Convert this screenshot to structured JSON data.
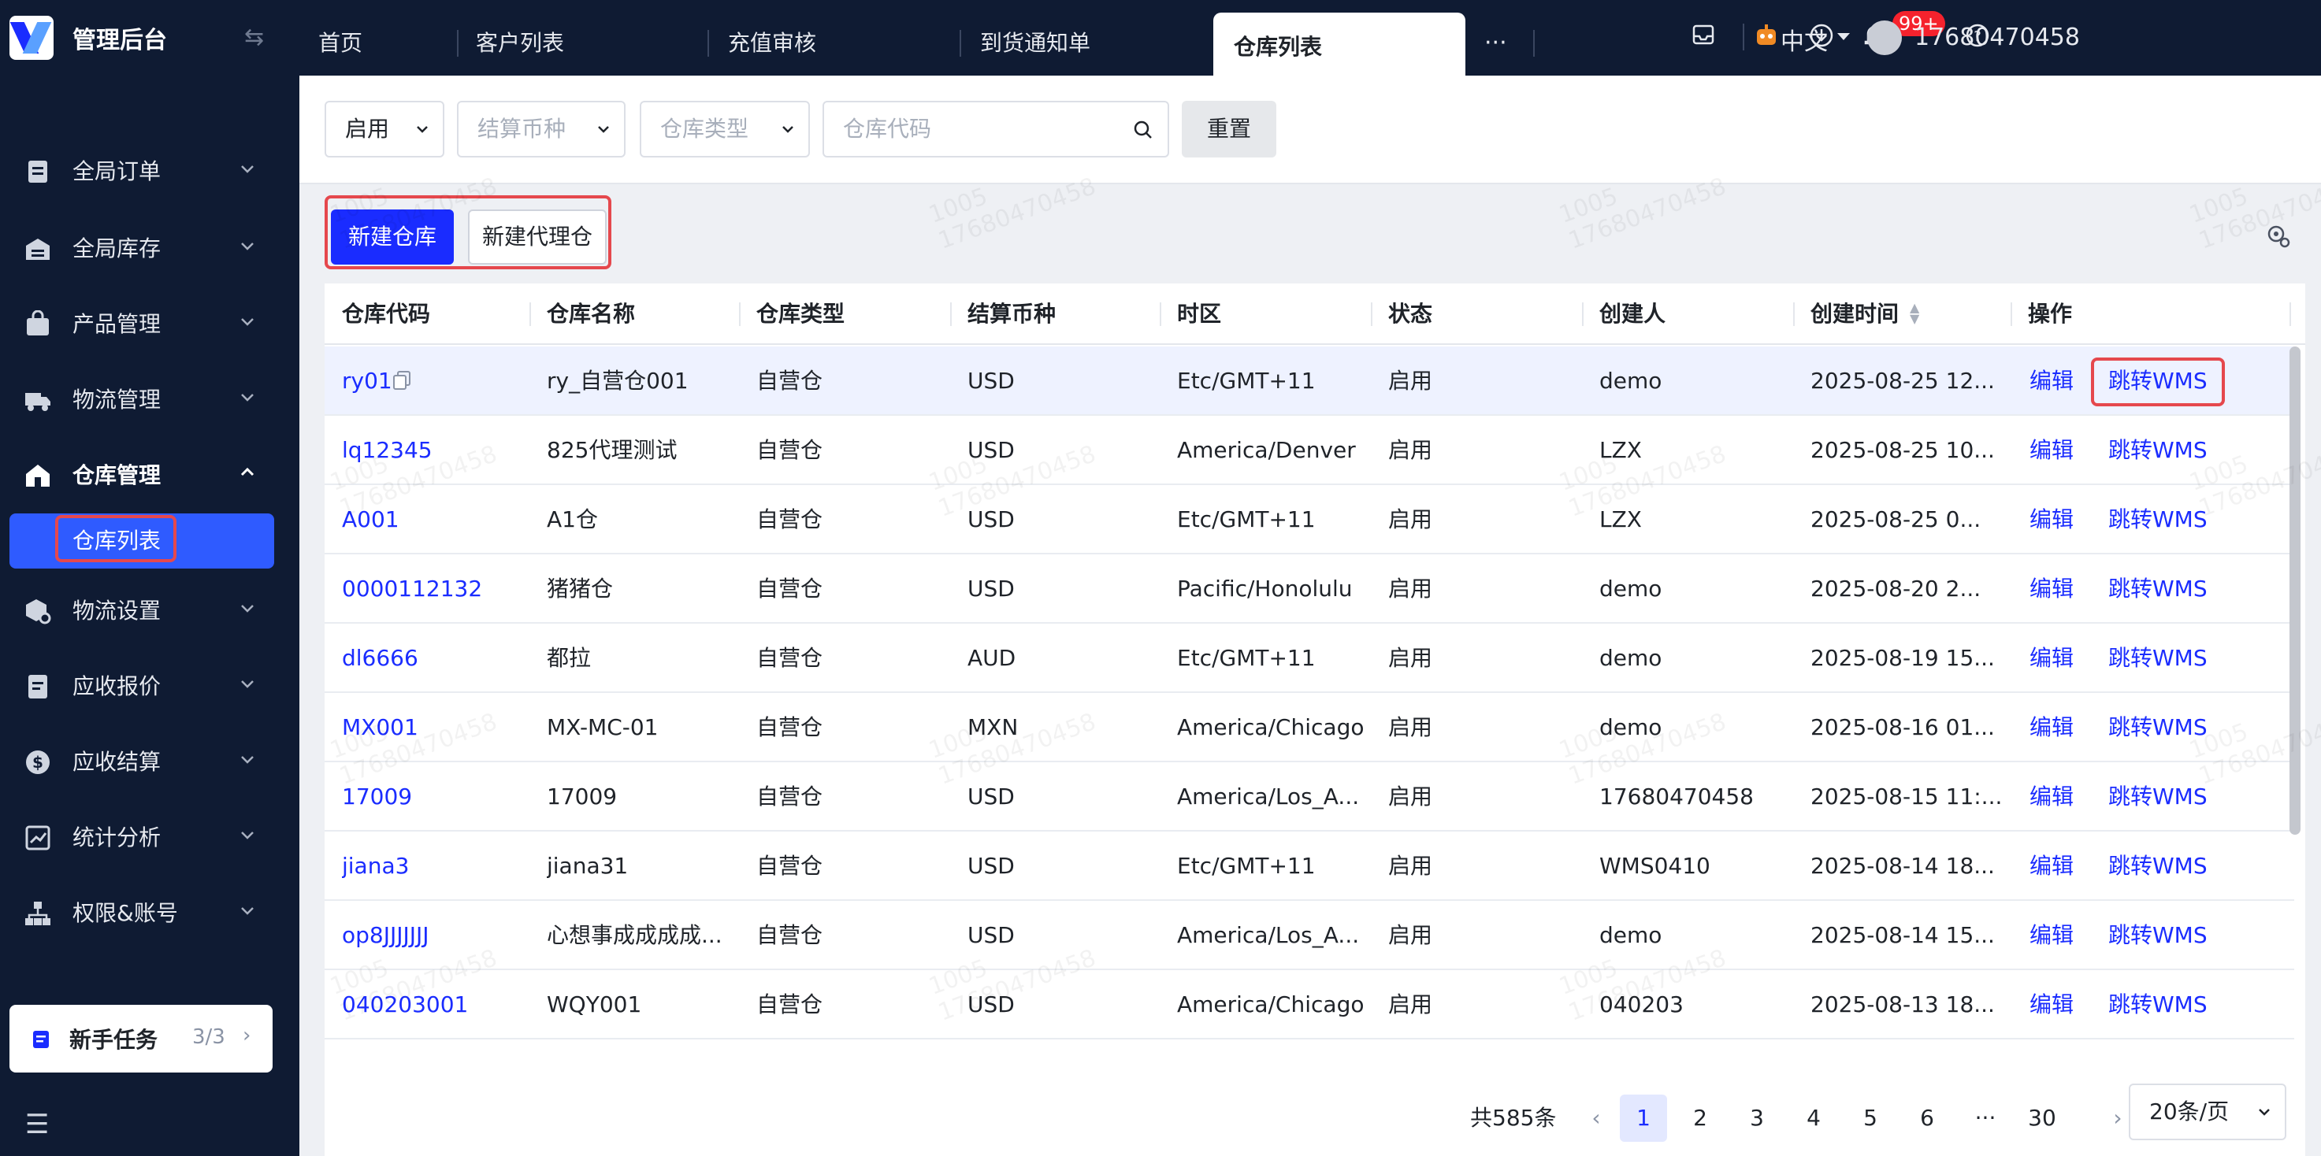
{
  "app": {
    "title": "管理后台"
  },
  "sidebar": {
    "items": [
      {
        "label": "全局订单",
        "icon": "clipboard-icon"
      },
      {
        "label": "全局库存",
        "icon": "warehouse-icon"
      },
      {
        "label": "产品管理",
        "icon": "bag-icon"
      },
      {
        "label": "物流管理",
        "icon": "truck-icon"
      },
      {
        "label": "仓库管理",
        "icon": "home-icon",
        "open": true
      },
      {
        "label": "物流设置",
        "icon": "cube-settings-icon"
      },
      {
        "label": "应收报价",
        "icon": "document-icon"
      },
      {
        "label": "应收结算",
        "icon": "dollar-icon"
      },
      {
        "label": "统计分析",
        "icon": "chart-icon"
      },
      {
        "label": "权限&账号",
        "icon": "org-icon"
      }
    ],
    "active_sub": "仓库列表",
    "newbie": {
      "label": "新手任务",
      "progress": "3/3"
    }
  },
  "tabs": [
    "首页",
    "客户列表",
    "充值审核",
    "到货通知单",
    "仓库列表"
  ],
  "topbar": {
    "badge": "99+",
    "language": "中文",
    "user": "17680470458"
  },
  "filters": {
    "status": "启用",
    "currency_placeholder": "结算币种",
    "type_placeholder": "仓库类型",
    "code_placeholder": "仓库代码",
    "reset": "重置"
  },
  "actions": {
    "new_warehouse": "新建仓库",
    "new_agent": "新建代理仓"
  },
  "table": {
    "headers": [
      "仓库代码",
      "仓库名称",
      "仓库类型",
      "结算币种",
      "时区",
      "状态",
      "创建人",
      "创建时间",
      "操作"
    ],
    "edit": "编辑",
    "jump": "跳转WMS",
    "rows": [
      {
        "code": "ry01",
        "name": "ry_自营仓001",
        "type": "自营仓",
        "currency": "USD",
        "tz": "Etc/GMT+11",
        "status": "启用",
        "creator": "demo",
        "created": "2025-08-25 12..."
      },
      {
        "code": "lq12345",
        "name": "825代理测试",
        "type": "自营仓",
        "currency": "USD",
        "tz": "America/Denver",
        "status": "启用",
        "creator": "LZX",
        "created": "2025-08-25 10..."
      },
      {
        "code": "A001",
        "name": "A1仓",
        "type": "自营仓",
        "currency": "USD",
        "tz": "Etc/GMT+11",
        "status": "启用",
        "creator": "LZX",
        "created": "2025-08-25 0..."
      },
      {
        "code": "0000112132",
        "name": "猪猪仓",
        "type": "自营仓",
        "currency": "USD",
        "tz": "Pacific/Honolulu",
        "status": "启用",
        "creator": "demo",
        "created": "2025-08-20 2..."
      },
      {
        "code": "dl6666",
        "name": "都拉",
        "type": "自营仓",
        "currency": "AUD",
        "tz": "Etc/GMT+11",
        "status": "启用",
        "creator": "demo",
        "created": "2025-08-19 15..."
      },
      {
        "code": "MX001",
        "name": "MX-MC-01",
        "type": "自营仓",
        "currency": "MXN",
        "tz": "America/Chicago",
        "status": "启用",
        "creator": "demo",
        "created": "2025-08-16 01..."
      },
      {
        "code": "17009",
        "name": "17009",
        "type": "自营仓",
        "currency": "USD",
        "tz": "America/Los_A...",
        "status": "启用",
        "creator": "17680470458",
        "created": "2025-08-15 11:..."
      },
      {
        "code": "jiana3",
        "name": "jiana31",
        "type": "自营仓",
        "currency": "USD",
        "tz": "Etc/GMT+11",
        "status": "启用",
        "creator": "WMS0410",
        "created": "2025-08-14 18..."
      },
      {
        "code": "op8JJJJJJJ",
        "name": "心想事成成成成...",
        "type": "自营仓",
        "currency": "USD",
        "tz": "America/Los_A...",
        "status": "启用",
        "creator": "demo",
        "created": "2025-08-14 15..."
      },
      {
        "code": "040203001",
        "name": "WQY001",
        "type": "自营仓",
        "currency": "USD",
        "tz": "America/Chicago",
        "status": "启用",
        "creator": "040203",
        "created": "2025-08-13 18..."
      }
    ]
  },
  "pagination": {
    "total": "共585条",
    "pages": [
      "1",
      "2",
      "3",
      "4",
      "5",
      "6",
      "···",
      "30"
    ],
    "page_size": "20条/页"
  },
  "watermark": [
    "1005",
    "17680470458"
  ]
}
